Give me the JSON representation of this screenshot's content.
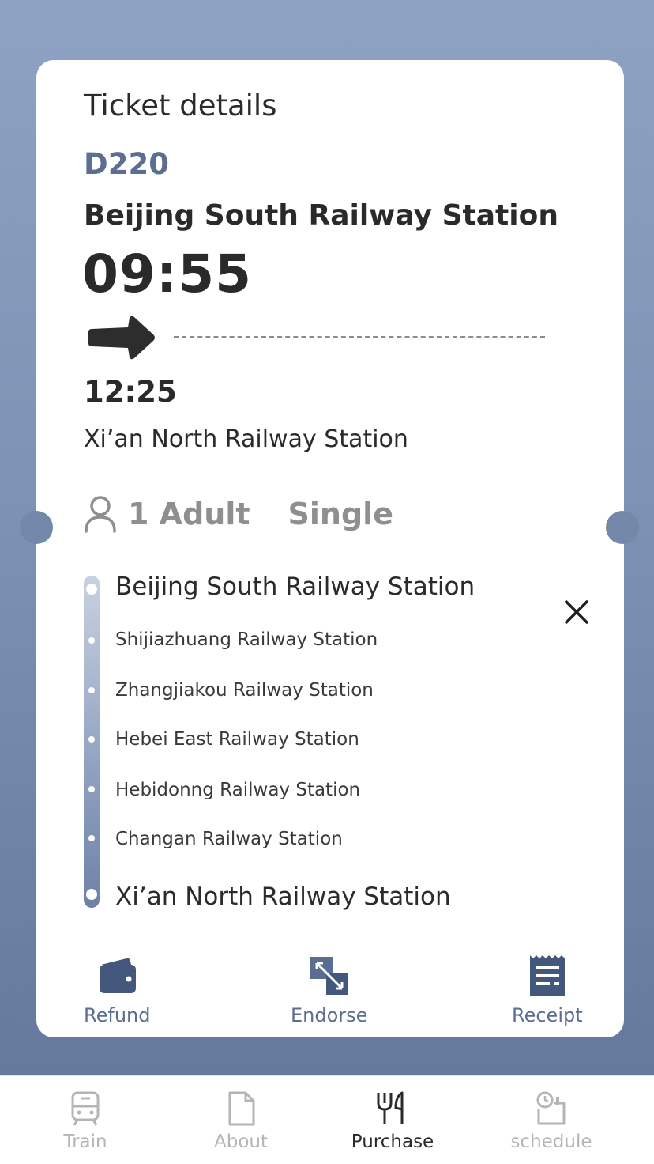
{
  "ticket": {
    "title": "Ticket details",
    "train_number": "D220",
    "departure_station": "Beijing South Railway Station",
    "departure_time": "09:55",
    "arrival_time": "12:25",
    "arrival_station": "Xi’an North Railway Station",
    "passengers": "1 Adult",
    "ticket_type": "Single"
  },
  "route": {
    "origin": "Beijing South Railway Station",
    "stops": [
      "Shijiazhuang Railway Station",
      "Zhangjiakou Railway Station",
      "Hebei East Railway Station",
      "Hebidonng Railway Station",
      "Changan Railway Station"
    ],
    "destination": "Xi’an North Railway Station"
  },
  "actions": {
    "refund": "Refund",
    "endorse": "Endorse",
    "receipt": "Receipt"
  },
  "tabs": {
    "train": "Train",
    "about": "About",
    "purchase": "Purchase",
    "schedule": "schedule",
    "active": "purchase"
  },
  "colors": {
    "accent": "#5c6f93",
    "icon": "#44577d",
    "background_top": "#8ea3c3",
    "background_bottom": "#61759a"
  }
}
